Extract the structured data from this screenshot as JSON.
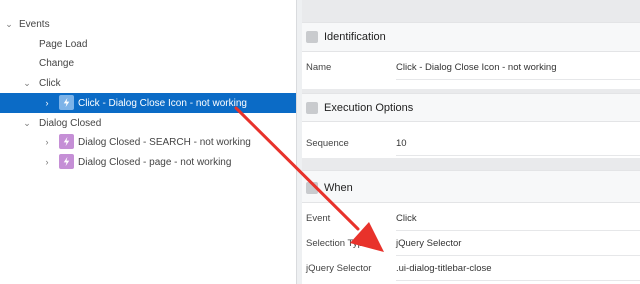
{
  "tree": {
    "events_label": "Events",
    "page_load": "Page Load",
    "change": "Change",
    "click": "Click",
    "click_action": "Click - Dialog Close Icon - not working",
    "dialog_closed": "Dialog Closed",
    "dc_search": "Dialog Closed - SEARCH - not working",
    "dc_page": "Dialog Closed - page - not working"
  },
  "identification": {
    "title": "Identification",
    "name_label": "Name",
    "name_value": "Click - Dialog Close Icon - not working"
  },
  "execution": {
    "title": "Execution Options",
    "sequence_label": "Sequence",
    "sequence_value": "10"
  },
  "when": {
    "title": "When",
    "event_label": "Event",
    "event_value": "Click",
    "selection_type_label": "Selection Type",
    "selection_type_value": "jQuery Selector",
    "jquery_label": "jQuery Selector",
    "jquery_value": ".ui-dialog-titlebar-close"
  },
  "colors": {
    "selected": "#0b6bc6",
    "arrow": "#e8322b",
    "action_icon": "#c58fd6"
  }
}
